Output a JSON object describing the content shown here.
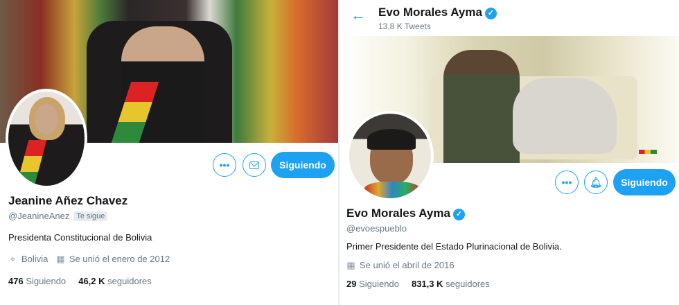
{
  "left_profile": {
    "name": "Jeanine Añez Chavez",
    "handle": "@JeanineAnez",
    "follows_you_badge": "Te sigue",
    "bio": "Presidenta Constitucional de Bolivia",
    "location": "Bolivia",
    "joined": "Se unió el enero de 2012",
    "following_count": "476",
    "following_label": "Siguiendo",
    "followers_count": "46,2 K",
    "followers_label": "seguidores",
    "more_icon": "more-icon",
    "message_icon": "mail-icon",
    "follow_button_label": "Siguiendo"
  },
  "right_profile": {
    "header_name": "Evo Morales Ayma",
    "header_tweets": "13,8 K Tweets",
    "name": "Evo Morales Ayma",
    "handle": "@evoespueblo",
    "bio": "Primer Presidente del Estado Plurinacional de Bolivia.",
    "joined": "Se unió el abril de 2016",
    "following_count": "29",
    "following_label": "Siguiendo",
    "followers_count": "831,3 K",
    "followers_label": "seguidores",
    "more_icon": "more-icon",
    "notify_icon": "bell-plus-icon",
    "follow_button_label": "Siguiendo"
  },
  "colors": {
    "accent": "#1da1f2",
    "muted_text": "#657786",
    "primary_text": "#14171a"
  }
}
